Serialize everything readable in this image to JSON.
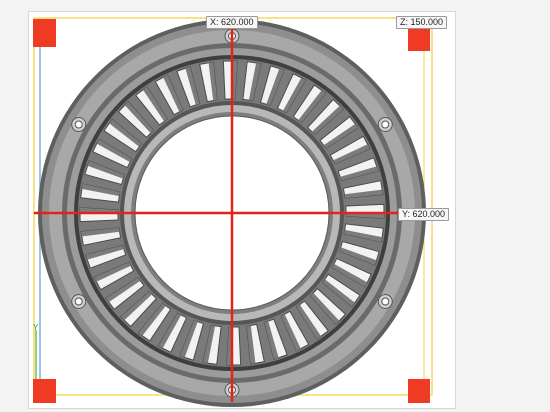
{
  "readouts": {
    "x": "X: 620.000",
    "z": "Z: 150.000",
    "y": "Y: 620.000"
  },
  "axis_tag": "Y",
  "colors": {
    "crosshair": "#e8201c",
    "marker": "#ef3b24",
    "guide_yellow": "#f4d24a",
    "guide_blue": "#7fb2e0",
    "guide_green": "#6cbf5a",
    "part_dark": "#5a5a5a",
    "part_mid": "#8c8c8c",
    "part_light": "#d9d9d9"
  },
  "part": {
    "description_icon": "turbine-vane-ring",
    "vane_count": 40,
    "bolt_holes": 6
  }
}
